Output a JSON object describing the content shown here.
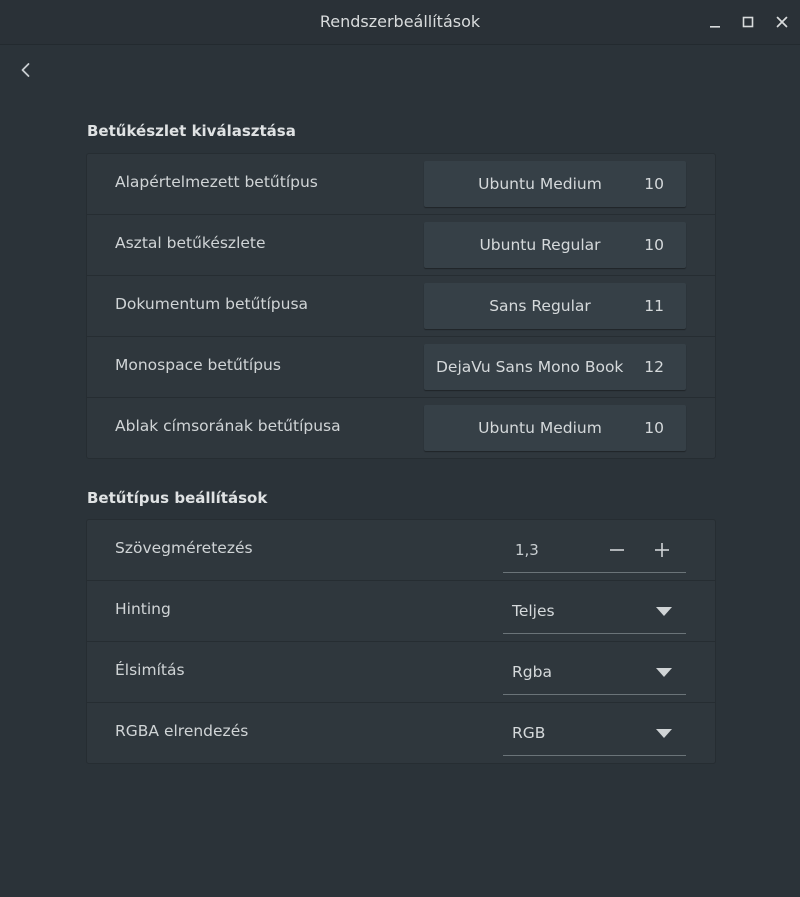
{
  "window": {
    "title": "Rendszerbeállítások"
  },
  "sections": {
    "fonts": {
      "title": "Betűkészlet kiválasztása",
      "rows": [
        {
          "label": "Alapértelmezett betűtípus",
          "font": "Ubuntu Medium",
          "size": "10"
        },
        {
          "label": "Asztal betűkészlete",
          "font": "Ubuntu Regular",
          "size": "10"
        },
        {
          "label": "Dokumentum betűtípusa",
          "font": "Sans Regular",
          "size": "11"
        },
        {
          "label": "Monospace betűtípus",
          "font": "DejaVu Sans Mono Book",
          "size": "12"
        },
        {
          "label": "Ablak címsorának betűtípusa",
          "font": "Ubuntu Medium",
          "size": "10"
        }
      ]
    },
    "settings": {
      "title": "Betűtípus beállítások",
      "scaling": {
        "label": "Szövegméretezés",
        "value": "1,3"
      },
      "hinting": {
        "label": "Hinting",
        "value": "Teljes"
      },
      "antialias": {
        "label": "Élsimítás",
        "value": "Rgba"
      },
      "rgba_order": {
        "label": "RGBA elrendezés",
        "value": "RGB"
      }
    }
  },
  "icons": {
    "back": "chevron-left-icon",
    "minimize": "minimize-icon",
    "maximize": "maximize-icon",
    "close": "close-icon",
    "dropdown": "triangle-down-icon"
  }
}
